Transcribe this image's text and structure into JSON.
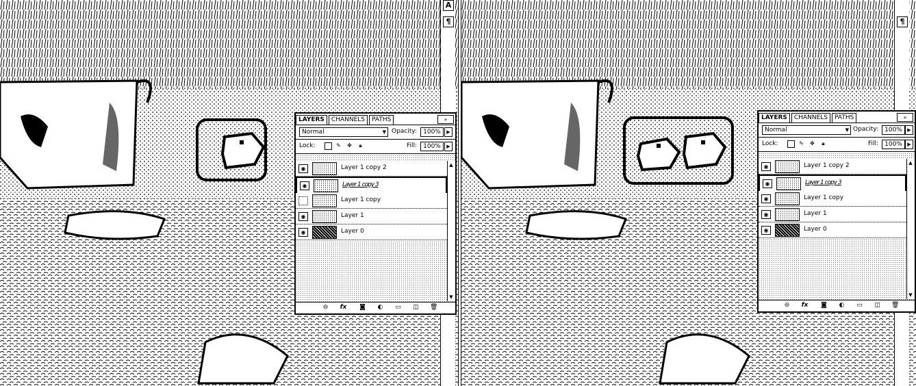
{
  "tools": {
    "type_icon_label": "A",
    "paragraph_icon_label": "¶"
  },
  "left_panel": {
    "tabs": [
      "LAYERS",
      "CHANNELS",
      "PATHS"
    ],
    "menu_icon": "»",
    "blend_mode": "Normal",
    "opacity_label": "Opacity:",
    "opacity_value": "100%",
    "lock_label": "Lock:",
    "fill_label": "Fill:",
    "fill_value": "100%",
    "layers": [
      {
        "name": "Layer 1 copy 2",
        "visible": true,
        "selected": false
      },
      {
        "name": "Layer 1 copy 3",
        "visible": true,
        "selected": true
      },
      {
        "name": "Layer 1 copy",
        "visible": false,
        "selected": false
      },
      {
        "name": "Layer 1",
        "visible": true,
        "selected": false
      },
      {
        "name": "Layer 0",
        "visible": true,
        "selected": false
      }
    ]
  },
  "right_panel": {
    "tabs": [
      "LAYERS",
      "CHANNELS",
      "PATHS"
    ],
    "menu_icon": "»",
    "blend_mode": "Normal",
    "opacity_label": "Opacity:",
    "opacity_value": "100%",
    "lock_label": "Lock:",
    "fill_label": "Fill:",
    "fill_value": "100%",
    "layers": [
      {
        "name": "Layer 1 copy 2",
        "visible": true,
        "selected": false
      },
      {
        "name": "Layer 1 copy 3",
        "visible": true,
        "selected": true
      },
      {
        "name": "Layer 1 copy",
        "visible": true,
        "selected": false
      },
      {
        "name": "Layer 1",
        "visible": true,
        "selected": false
      },
      {
        "name": "Layer 0",
        "visible": true,
        "selected": false
      }
    ]
  },
  "bottom_bar_icons": [
    "link-icon",
    "fx-icon",
    "mask-icon",
    "adjustment-icon",
    "group-icon",
    "new-layer-icon",
    "trash-icon"
  ]
}
